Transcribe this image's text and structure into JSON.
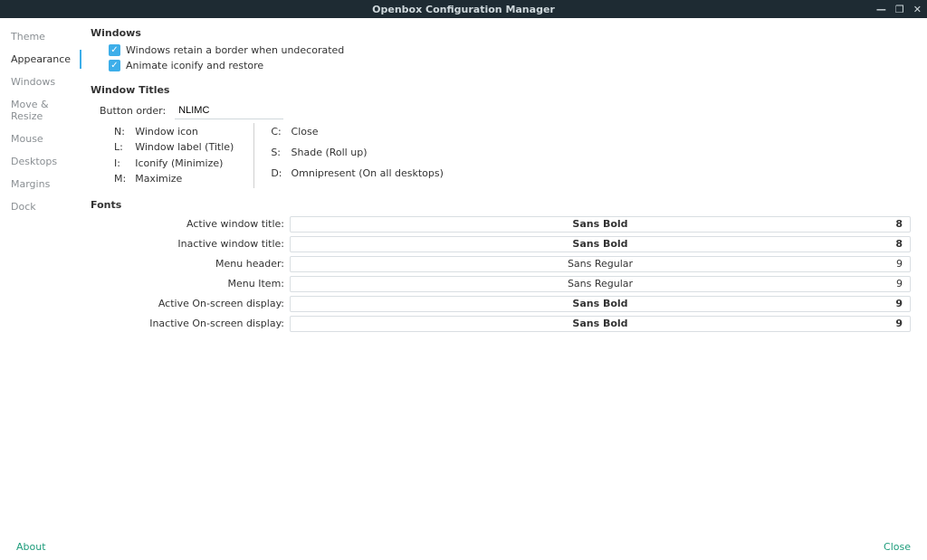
{
  "titlebar": {
    "title": "Openbox Configuration Manager"
  },
  "sidebar": {
    "items": [
      {
        "label": "Theme"
      },
      {
        "label": "Appearance"
      },
      {
        "label": "Windows"
      },
      {
        "label": "Move & Resize"
      },
      {
        "label": "Mouse"
      },
      {
        "label": "Desktops"
      },
      {
        "label": "Margins"
      },
      {
        "label": "Dock"
      }
    ],
    "active_index": 1
  },
  "windows_section": {
    "heading": "Windows",
    "checkbox1_label": "Windows retain a border when undecorated",
    "checkbox2_label": "Animate iconify and restore"
  },
  "window_titles": {
    "heading": "Window Titles",
    "button_order_label": "Button order:",
    "button_order_value": "NLIMC",
    "legend_left": [
      {
        "k": "N:",
        "v": "Window icon"
      },
      {
        "k": "L:",
        "v": "Window label (Title)"
      },
      {
        "k": "I:",
        "v": "Iconify (Minimize)"
      },
      {
        "k": "M:",
        "v": "Maximize"
      }
    ],
    "legend_right": [
      {
        "k": "C:",
        "v": "Close"
      },
      {
        "k": "S:",
        "v": "Shade (Roll up)"
      },
      {
        "k": "D:",
        "v": "Omnipresent (On all desktops)"
      }
    ]
  },
  "fonts_section": {
    "heading": "Fonts",
    "rows": [
      {
        "label": "Active window title:",
        "font": "Sans Bold",
        "size": "8",
        "bold": true
      },
      {
        "label": "Inactive window title:",
        "font": "Sans Bold",
        "size": "8",
        "bold": true
      },
      {
        "label": "Menu header:",
        "font": "Sans Regular",
        "size": "9",
        "bold": false
      },
      {
        "label": "Menu Item:",
        "font": "Sans Regular",
        "size": "9",
        "bold": false
      },
      {
        "label": "Active On-screen display:",
        "font": "Sans Bold",
        "size": "9",
        "bold": true
      },
      {
        "label": "Inactive On-screen display:",
        "font": "Sans Bold",
        "size": "9",
        "bold": true
      }
    ]
  },
  "footer": {
    "about": "About",
    "close": "Close"
  }
}
